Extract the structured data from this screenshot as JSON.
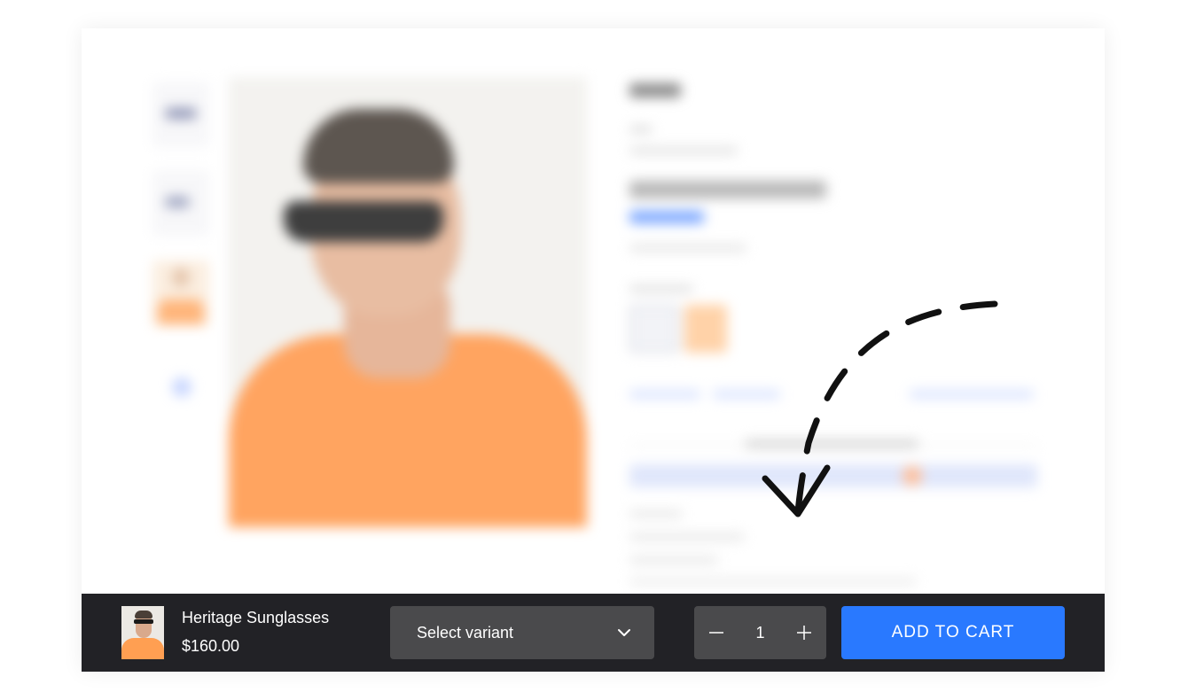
{
  "sticky_bar": {
    "product_name": "Heritage Sunglasses",
    "product_price": "$160.00",
    "variant_placeholder": "Select variant",
    "quantity": "1",
    "add_to_cart_label": "ADD TO CART"
  },
  "colors": {
    "bar_background": "#222226",
    "control_background": "#4a4a4c",
    "accent": "#2979ff",
    "annotation_stroke": "#111111"
  },
  "icons": {
    "variant_dropdown": "chevron-down-icon",
    "decrease": "minus-icon",
    "increase": "plus-icon",
    "annotation": "dashed-arrow-icon"
  }
}
